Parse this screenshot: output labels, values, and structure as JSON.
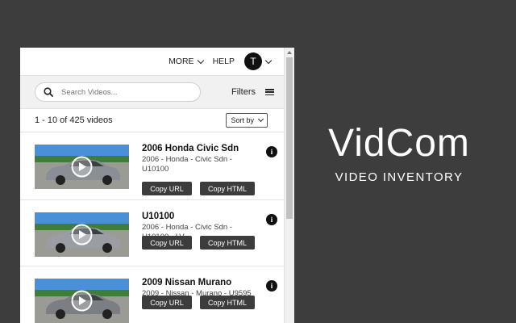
{
  "header": {
    "more_label": "MORE",
    "help_label": "HELP",
    "avatar_initial": "T"
  },
  "search": {
    "placeholder": "Search Videos...",
    "value": "",
    "filters_label": "Filters"
  },
  "results": {
    "count_text": "1 - 10 of 425 videos",
    "sort_label": "Sort by"
  },
  "videos": [
    {
      "title": "2006 Honda Civic Sdn",
      "subtitle": "2006 - Honda - Civic Sdn - U10100",
      "copy_url_label": "Copy URL",
      "copy_html_label": "Copy HTML",
      "car_color": "#8a8f96"
    },
    {
      "title": "U10100",
      "subtitle": "2006 - Honda - Civic Sdn - U10100 - LV",
      "copy_url_label": "Copy URL",
      "copy_html_label": "Copy HTML",
      "car_color": "#9a9ea4"
    },
    {
      "title": "2009 Nissan Murano",
      "subtitle": "2009 - Nissan - Murano - U9595",
      "copy_url_label": "Copy URL",
      "copy_html_label": "Copy HTML",
      "car_color": "#7b7e82"
    }
  ],
  "brand": {
    "name": "VidCom",
    "tagline": "VIDEO INVENTORY"
  },
  "colors": {
    "background": "#3d3d3d",
    "button": "#3c3c3c",
    "sky": "#4a90d9"
  },
  "icons": [
    "chevron-down-icon",
    "search-icon",
    "menu-icon",
    "info-icon",
    "play-icon"
  ]
}
